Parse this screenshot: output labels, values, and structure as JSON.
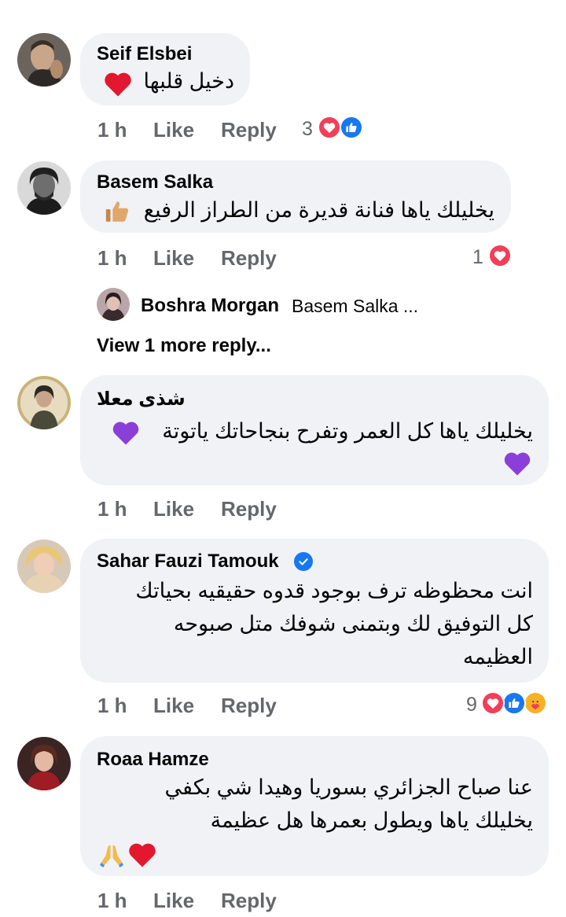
{
  "comments": [
    {
      "author": "Seif Elsbei",
      "lines": [
        "دخيل قلبها"
      ],
      "emoji_icons": [
        "red-heart"
      ],
      "time": "1 h",
      "like_label": "Like",
      "reply_label": "Reply",
      "reaction_count": "3",
      "reaction_icons": [
        "love",
        "like"
      ]
    },
    {
      "author": "Basem Salka",
      "lines": [
        "يخليلك ياها فنانة قديرة من الطراز الرفيع"
      ],
      "emoji_icons": [
        "thumbs-up"
      ],
      "time": "1 h",
      "like_label": "Like",
      "reply_label": "Reply",
      "reaction_count": "1",
      "reaction_icons": [
        "love"
      ],
      "reply_preview": {
        "author": "Boshra Morgan",
        "snippet": "Basem Salka ...",
        "view_more": "View 1 more reply..."
      }
    },
    {
      "author": "شذى معلا",
      "lines": [
        "يخليلك ياها كل العمر وتفرح بنجاحاتك ياتوتة"
      ],
      "emoji_icons": [
        "purple-heart",
        "purple-heart"
      ],
      "time": "1 h",
      "like_label": "Like",
      "reply_label": "Reply"
    },
    {
      "author": "Sahar Fauzi Tamouk",
      "verified": true,
      "lines": [
        "انت محظوظه ترف بوجود قدوه حقيقيه بحياتك",
        "كل التوفيق لك وبتمنى شوفك متل صبوحه",
        "العظيمه"
      ],
      "time": "1 h",
      "like_label": "Like",
      "reply_label": "Reply",
      "reaction_count": "9",
      "reaction_icons": [
        "love",
        "like",
        "care"
      ]
    },
    {
      "author": "Roaa Hamze",
      "lines": [
        "عنا صباح الجزائري بسوريا وهيدا شي بكفي",
        "يخليلك ياها ويطول بعمرها هل عظيمة"
      ],
      "emoji_icons": [
        "folded-hands",
        "red-heart"
      ],
      "time": "1 h",
      "like_label": "Like",
      "reply_label": "Reply"
    }
  ],
  "colors": {
    "bubble": "#f0f2f5",
    "meta_text": "#65676b",
    "love": "#f33e58",
    "like": "#1877f2",
    "care": "#f7b125",
    "purple_heart": "#8b3fd9"
  }
}
